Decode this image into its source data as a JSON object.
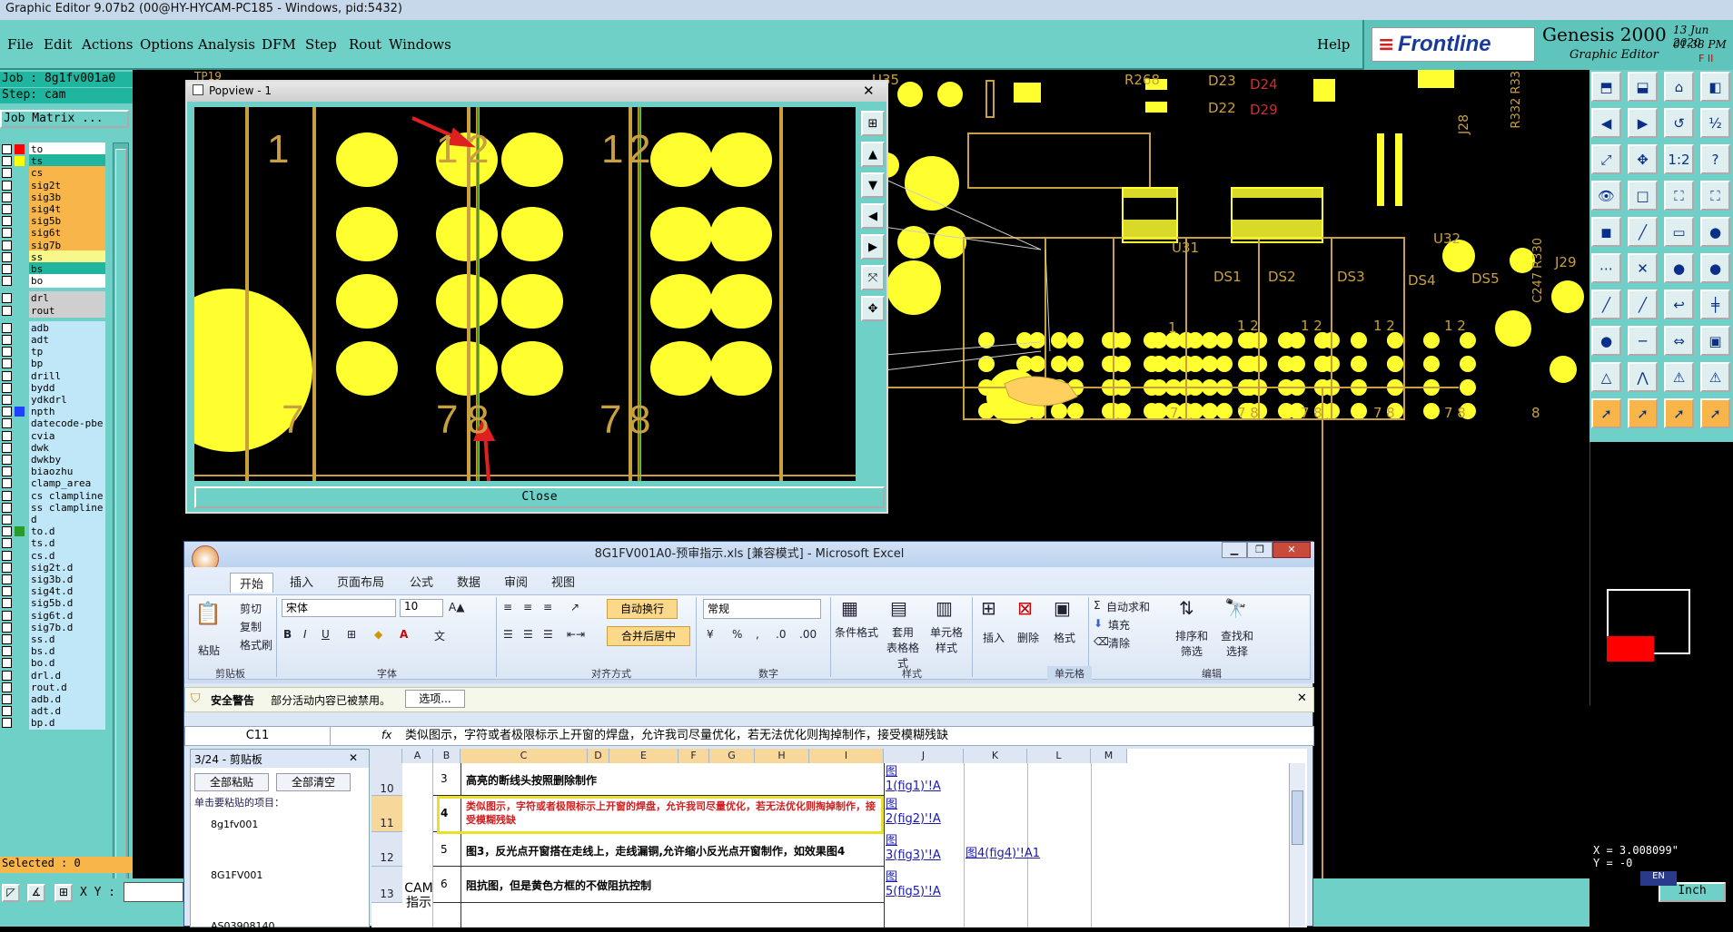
{
  "titlebar": {
    "text": "Graphic Editor 9.07b2 (00@HY-HYCAM-PC185 - Windows, pid:5432)"
  },
  "menu": {
    "items": [
      "File",
      "Edit",
      "Actions",
      "Options",
      "Analysis",
      "DFM",
      "Step",
      "Rout",
      "Windows"
    ],
    "help": "Help"
  },
  "brand": {
    "logo": "Frontline",
    "product": "Genesis 2000",
    "subtitle": "Graphic Editor",
    "date": "13 Jun 2020",
    "time": "01:38 PM",
    "extra": "F  II"
  },
  "job": {
    "job_label": "Job : 8g1fv001a0",
    "step_label": "Step: cam",
    "matrix_button": "Job Matrix ..."
  },
  "layers": [
    {
      "name": "to",
      "color": "#ff0000",
      "bg": "#ffffff"
    },
    {
      "name": "ts",
      "color": "#ffff00",
      "bg": "#1fb59e"
    },
    {
      "name": "cs",
      "color": "",
      "bg": "#f7b54a"
    },
    {
      "name": "sig2t",
      "color": "",
      "bg": "#f7b54a"
    },
    {
      "name": "sig3b",
      "color": "",
      "bg": "#f7b54a"
    },
    {
      "name": "sig4t",
      "color": "",
      "bg": "#f7b54a"
    },
    {
      "name": "sig5b",
      "color": "",
      "bg": "#f7b54a"
    },
    {
      "name": "sig6t",
      "color": "",
      "bg": "#f7b54a"
    },
    {
      "name": "sig7b",
      "color": "",
      "bg": "#f7b54a"
    },
    {
      "name": "ss",
      "color": "",
      "bg": "#f7f78a"
    },
    {
      "name": "bs",
      "color": "",
      "bg": "#1fb59e"
    },
    {
      "name": "bo",
      "color": "",
      "bg": "#ffffff"
    },
    {
      "name": "drl",
      "color": "",
      "bg": "#cfcfcf"
    },
    {
      "name": "rout",
      "color": "",
      "bg": "#cfcfcf"
    },
    {
      "name": "adb",
      "color": "",
      "bg": "#bfe7f7"
    },
    {
      "name": "adt",
      "color": "",
      "bg": "#bfe7f7"
    },
    {
      "name": "tp",
      "color": "",
      "bg": "#bfe7f7"
    },
    {
      "name": "bp",
      "color": "",
      "bg": "#bfe7f7"
    },
    {
      "name": "drill",
      "color": "",
      "bg": "#bfe7f7"
    },
    {
      "name": "bydd",
      "color": "",
      "bg": "#bfe7f7"
    },
    {
      "name": "ydkdrl",
      "color": "",
      "bg": "#bfe7f7"
    },
    {
      "name": "npth",
      "color": "#2040ff",
      "bg": "#bfe7f7"
    },
    {
      "name": "datecode-pbe",
      "color": "",
      "bg": "#bfe7f7"
    },
    {
      "name": "cvia",
      "color": "",
      "bg": "#bfe7f7"
    },
    {
      "name": "dwk",
      "color": "",
      "bg": "#bfe7f7"
    },
    {
      "name": "dwkby",
      "color": "",
      "bg": "#bfe7f7"
    },
    {
      "name": "biaozhu",
      "color": "",
      "bg": "#bfe7f7"
    },
    {
      "name": "clamp_area",
      "color": "",
      "bg": "#bfe7f7"
    },
    {
      "name": "cs_clampline",
      "color": "",
      "bg": "#bfe7f7"
    },
    {
      "name": "ss_clampline",
      "color": "",
      "bg": "#bfe7f7"
    },
    {
      "name": "d",
      "color": "",
      "bg": "#bfe7f7"
    },
    {
      "name": "to.d",
      "color": "#2a9a2a",
      "bg": "#bfe7f7"
    },
    {
      "name": "ts.d",
      "color": "",
      "bg": "#bfe7f7"
    },
    {
      "name": "cs.d",
      "color": "",
      "bg": "#bfe7f7"
    },
    {
      "name": "sig2t.d",
      "color": "",
      "bg": "#bfe7f7"
    },
    {
      "name": "sig3b.d",
      "color": "",
      "bg": "#bfe7f7"
    },
    {
      "name": "sig4t.d",
      "color": "",
      "bg": "#bfe7f7"
    },
    {
      "name": "sig5b.d",
      "color": "",
      "bg": "#bfe7f7"
    },
    {
      "name": "sig6t.d",
      "color": "",
      "bg": "#bfe7f7"
    },
    {
      "name": "sig7b.d",
      "color": "",
      "bg": "#bfe7f7"
    },
    {
      "name": "ss.d",
      "color": "",
      "bg": "#bfe7f7"
    },
    {
      "name": "bs.d",
      "color": "",
      "bg": "#bfe7f7"
    },
    {
      "name": "bo.d",
      "color": "",
      "bg": "#bfe7f7"
    },
    {
      "name": "drl.d",
      "color": "",
      "bg": "#bfe7f7"
    },
    {
      "name": "rout.d",
      "color": "",
      "bg": "#bfe7f7"
    },
    {
      "name": "adb.d",
      "color": "",
      "bg": "#bfe7f7"
    },
    {
      "name": "adt.d",
      "color": "",
      "bg": "#bfe7f7"
    },
    {
      "name": "bp.d",
      "color": "",
      "bg": "#bfe7f7"
    }
  ],
  "status": {
    "selected": "Selected : 0",
    "xy_label": "X Y :",
    "units": "Inch",
    "x": "X = 3.008099\"",
    "y": "Y = -0",
    "lang": "EN"
  },
  "canvas_labels": {
    "u35": "U35",
    "r268": "R268",
    "d23": "D23",
    "d22": "D22",
    "d24": "D24",
    "d29": "D29",
    "j28": "J28",
    "u31": "U31",
    "u32": "U32",
    "ds1": "DS1",
    "ds2": "DS2",
    "ds3": "DS3",
    "ds4": "DS4",
    "ds5": "DS5",
    "r332": "R332 R33",
    "c247": "C247 R330",
    "j29": "J29",
    "tp19": "TP19",
    "pin1": "1",
    "pin12": "1 2",
    "pin78": "7 8",
    "pin8": "8",
    "pin7": "7"
  },
  "popview": {
    "title": "Popview - 1",
    "close_button": "Close",
    "labels": {
      "l1": "1",
      "l12a": "1",
      "l12b": "2",
      "l12c": "1",
      "l12d": "2",
      "l7": "7",
      "l78a": "7",
      "l78b": "8",
      "l78c": "7",
      "l78d": "8"
    }
  },
  "excel": {
    "title": "8G1FV001A0-预审指示.xls  [兼容模式]  -  Microsoft Excel",
    "tabs": [
      "开始",
      "插入",
      "页面布局",
      "公式",
      "数据",
      "审阅",
      "视图"
    ],
    "clipboard": {
      "cut": "剪切",
      "copy": "复制",
      "paste": "粘贴",
      "format": "格式刷",
      "label": "剪贴板"
    },
    "font": {
      "name": "宋体",
      "size": "10",
      "label": "字体",
      "bold": "B",
      "italic": "I",
      "underline": "U"
    },
    "align": {
      "wrap": "自动换行",
      "merge": "合并后居中",
      "label": "对齐方式"
    },
    "number": {
      "format": "常规",
      "label": "数字",
      "percent": "%"
    },
    "styles": {
      "cond": "条件格式",
      "table": "套用\n表格格式",
      "cell": "单元格\n样式",
      "label": "样式"
    },
    "cells": {
      "insert": "插入",
      "delete": "删除",
      "format": "格式",
      "label": "单元格"
    },
    "edit": {
      "autosum": "自动求和",
      "fill": "填充",
      "clear": "清除",
      "sort": "排序和\n筛选",
      "find": "查找和\n选择",
      "label": "编辑"
    },
    "security": {
      "title": "安全警告",
      "message": "部分活动内容已被禁用。",
      "options": "选项..."
    },
    "namebox": "C11",
    "fx": "fx",
    "formula": "类似图示，字符或者极限标示上开窗的焊盘，允许我司尽量优化，若无法优化则掏掉制作，接受模糊残缺",
    "clip_panel": {
      "title": "3/24 - 剪贴板",
      "paste_all": "全部粘贴",
      "clear_all": "全部清空",
      "hint": "单击要粘贴的项目：",
      "items": [
        "8g1fv001",
        "8G1FV001",
        "AS03908140"
      ]
    },
    "columns": [
      "A",
      "B",
      "C",
      "D",
      "E",
      "F",
      "G",
      "H",
      "I",
      "J",
      "K",
      "L",
      "M"
    ],
    "rows": [
      {
        "num": "10",
        "b": "3",
        "c": "高亮的断线头按照删除制作",
        "j": "图\n1(fig1)'!A",
        "k": ""
      },
      {
        "num": "11",
        "b": "4",
        "c": "类似图示，字符或者极限标示上开窗的焊盘，允许我司尽量优化，若无法优化则掏掉制作，接受模糊残缺",
        "j": "图\n2(fig2)'!A",
        "k": ""
      },
      {
        "num": "12",
        "b": "5",
        "c": "图3，反光点开窗搭在走线上，走线漏铜,允许缩小反光点开窗制作，如效果图4",
        "j": "图\n3(fig3)'!A",
        "k": "图4(fig4)'!A1"
      },
      {
        "num": "13",
        "b": "6",
        "c": "阻抗图，但是黄色方框的不做阻抗控制",
        "j": "图\n5(fig5)'!A",
        "k": ""
      }
    ],
    "a_label": "CAM\n指示"
  }
}
